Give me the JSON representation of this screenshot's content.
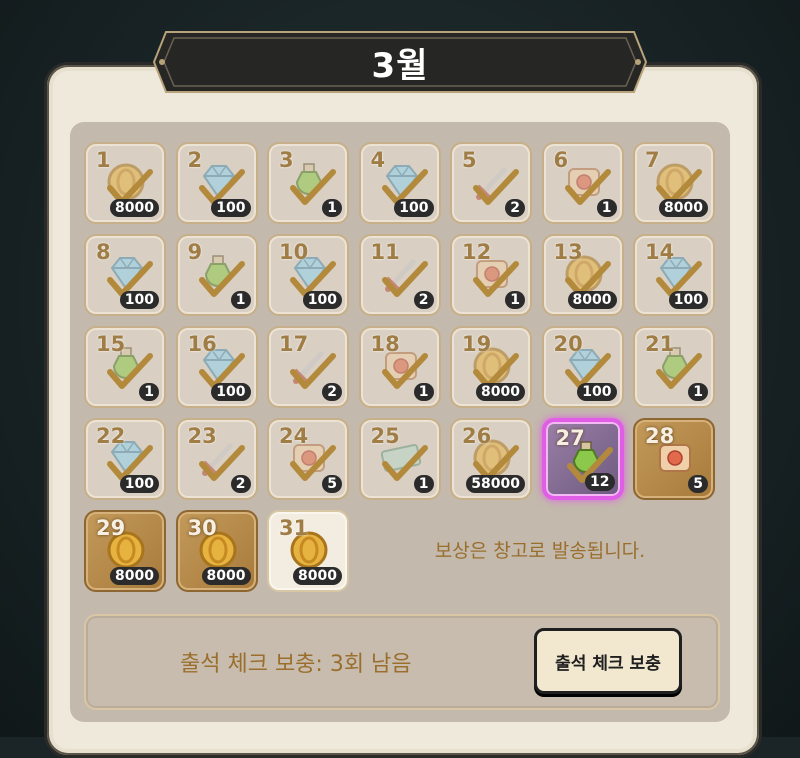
{
  "title": "3월",
  "notice": "보상은 창고로 발송됩니다.",
  "supplement": {
    "status": "출석 체크 보충: 3회 남음",
    "button": "출석 체크 보충"
  },
  "days": [
    {
      "day": "1",
      "item": "coin",
      "qty": "8000",
      "state": "claimed"
    },
    {
      "day": "2",
      "item": "gem",
      "qty": "100",
      "state": "claimed"
    },
    {
      "day": "3",
      "item": "potion",
      "qty": "1",
      "state": "claimed"
    },
    {
      "day": "4",
      "item": "gem",
      "qty": "100",
      "state": "claimed"
    },
    {
      "day": "5",
      "item": "sword",
      "qty": "2",
      "state": "claimed"
    },
    {
      "day": "6",
      "item": "scroll",
      "qty": "1",
      "state": "claimed"
    },
    {
      "day": "7",
      "item": "coin",
      "qty": "8000",
      "state": "claimed"
    },
    {
      "day": "8",
      "item": "gem",
      "qty": "100",
      "state": "claimed"
    },
    {
      "day": "9",
      "item": "potion",
      "qty": "1",
      "state": "claimed"
    },
    {
      "day": "10",
      "item": "gem",
      "qty": "100",
      "state": "claimed"
    },
    {
      "day": "11",
      "item": "sword",
      "qty": "2",
      "state": "claimed"
    },
    {
      "day": "12",
      "item": "scroll",
      "qty": "1",
      "state": "claimed"
    },
    {
      "day": "13",
      "item": "coin",
      "qty": "8000",
      "state": "claimed"
    },
    {
      "day": "14",
      "item": "gem",
      "qty": "100",
      "state": "claimed"
    },
    {
      "day": "15",
      "item": "potion",
      "qty": "1",
      "state": "claimed"
    },
    {
      "day": "16",
      "item": "gem",
      "qty": "100",
      "state": "claimed"
    },
    {
      "day": "17",
      "item": "sword",
      "qty": "2",
      "state": "claimed"
    },
    {
      "day": "18",
      "item": "scroll",
      "qty": "1",
      "state": "claimed"
    },
    {
      "day": "19",
      "item": "coin",
      "qty": "8000",
      "state": "claimed"
    },
    {
      "day": "20",
      "item": "gem",
      "qty": "100",
      "state": "claimed"
    },
    {
      "day": "21",
      "item": "potion",
      "qty": "1",
      "state": "claimed"
    },
    {
      "day": "22",
      "item": "gem",
      "qty": "100",
      "state": "claimed"
    },
    {
      "day": "23",
      "item": "sword",
      "qty": "2",
      "state": "claimed"
    },
    {
      "day": "24",
      "item": "scroll",
      "qty": "5",
      "state": "claimed"
    },
    {
      "day": "25",
      "item": "ticket",
      "qty": "1",
      "state": "claimed"
    },
    {
      "day": "26",
      "item": "coin",
      "qty": "58000",
      "state": "claimed"
    },
    {
      "day": "27",
      "item": "potion",
      "qty": "12",
      "state": "today"
    },
    {
      "day": "28",
      "item": "scroll",
      "qty": "5",
      "state": "gold"
    },
    {
      "day": "29",
      "item": "coin",
      "qty": "8000",
      "state": "gold"
    },
    {
      "day": "30",
      "item": "coin",
      "qty": "8000",
      "state": "gold"
    },
    {
      "day": "31",
      "item": "coin",
      "qty": "8000",
      "state": "white"
    }
  ]
}
